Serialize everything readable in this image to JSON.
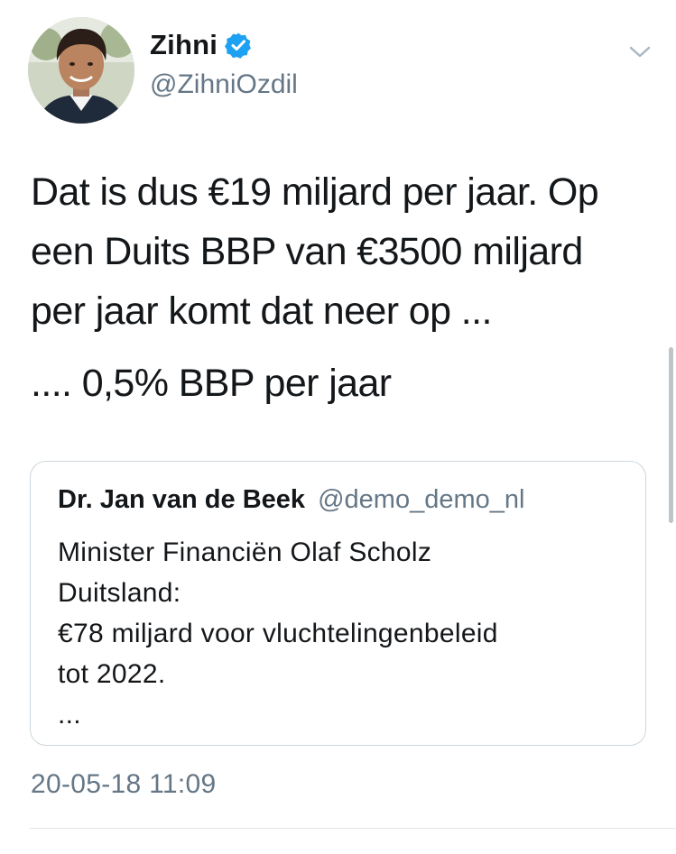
{
  "author": {
    "display_name": "Zihni",
    "handle": "@ZihniOzdil",
    "verified": true,
    "verified_color": "#1da1f2"
  },
  "menu": {
    "icon": "chevron-down-icon"
  },
  "tweet": {
    "lines": [
      "Dat is dus €19 miljard per jaar. Op",
      "een Duits BBP van €3500 miljard",
      "per jaar komt dat neer op ...",
      ".... 0,5% BBP per jaar"
    ]
  },
  "quoted_tweet": {
    "display_name": "Dr. Jan van de Beek",
    "handle": "@demo_demo_nl",
    "lines": [
      "Minister Financiën Olaf Scholz",
      "Duitsland:",
      "€78 miljard voor vluchtelingenbeleid",
      "tot 2022.",
      "..."
    ]
  },
  "timestamp": "20-05-18 11:09",
  "colors": {
    "text": "#14171a",
    "secondary": "#657786",
    "border": "#ccd6dd"
  }
}
